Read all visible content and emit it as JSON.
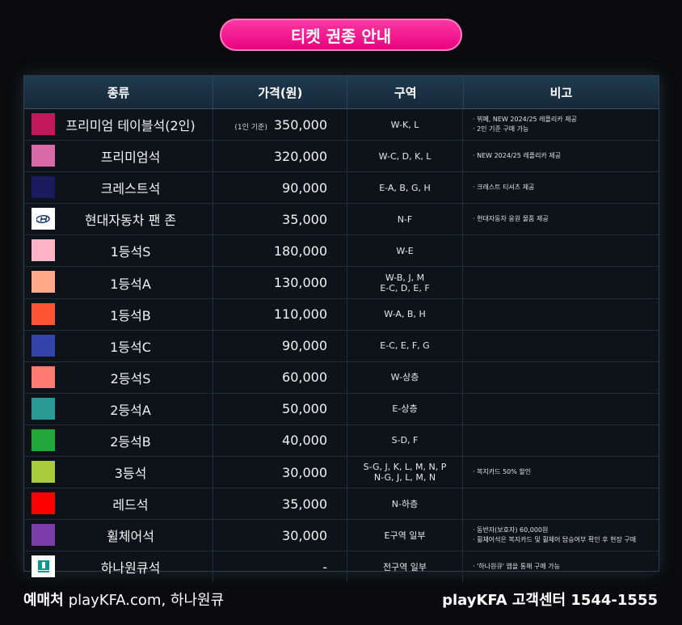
{
  "title": "티켓 권종 안내",
  "table": {
    "headers": [
      "종류",
      "가격(원)",
      "구역",
      "비고"
    ],
    "rows": [
      {
        "color": "#c2185b",
        "icon": "",
        "type": "프리미엄 테이블석(2인)",
        "price_note": "(1인 기준)",
        "price": "350,000",
        "zone": [
          "W-K, L"
        ],
        "notes": [
          "· 뷔페, NEW 2024/25 레플리카 제공",
          "· 2인 기준 구매 가능"
        ]
      },
      {
        "color": "#d96aa8",
        "icon": "",
        "type": "프리미엄석",
        "price_note": "",
        "price": "320,000",
        "zone": [
          "W-C, D, K, L"
        ],
        "notes": [
          "· NEW 2024/25 레플리카 제공"
        ]
      },
      {
        "color": "#1a1a5e",
        "icon": "",
        "type": "크레스트석",
        "price_note": "",
        "price": "90,000",
        "zone": [
          "E-A, B, G, H"
        ],
        "notes": [
          "· 크레스트 티셔츠 제공"
        ]
      },
      {
        "color": "#ffffff",
        "icon": "hyundai-logo-icon",
        "type": "현대자동차 팬 존",
        "price_note": "",
        "price": "35,000",
        "zone": [
          "N-F"
        ],
        "notes": [
          "· 현대자동차 응원 물품 제공"
        ]
      },
      {
        "color": "#ffb3c6",
        "icon": "",
        "type": "1등석S",
        "price_note": "",
        "price": "180,000",
        "zone": [
          "W-E"
        ],
        "notes": []
      },
      {
        "color": "#ffaa88",
        "icon": "",
        "type": "1등석A",
        "price_note": "",
        "price": "130,000",
        "zone": [
          "W-B, J, M",
          "E-C, D, E, F"
        ],
        "notes": []
      },
      {
        "color": "#ff5533",
        "icon": "",
        "type": "1등석B",
        "price_note": "",
        "price": "110,000",
        "zone": [
          "W-A, B, H"
        ],
        "notes": []
      },
      {
        "color": "#3344aa",
        "icon": "",
        "type": "1등석C",
        "price_note": "",
        "price": "90,000",
        "zone": [
          "E-C, E, F, G"
        ],
        "notes": []
      },
      {
        "color": "#ff7a70",
        "icon": "",
        "type": "2등석S",
        "price_note": "",
        "price": "60,000",
        "zone": [
          "W-상층"
        ],
        "notes": []
      },
      {
        "color": "#2a9a95",
        "icon": "",
        "type": "2등석A",
        "price_note": "",
        "price": "50,000",
        "zone": [
          "E-상층"
        ],
        "notes": []
      },
      {
        "color": "#22a83a",
        "icon": "",
        "type": "2등석B",
        "price_note": "",
        "price": "40,000",
        "zone": [
          "S-D, F"
        ],
        "notes": []
      },
      {
        "color": "#a8cc3a",
        "icon": "",
        "type": "3등석",
        "price_note": "",
        "price": "30,000",
        "zone": [
          "S-G, J, K, L, M, N, P",
          "N-G, J, L, M, N"
        ],
        "notes": [
          "· 복지카드 50% 할인"
        ]
      },
      {
        "color": "#ff0000",
        "icon": "",
        "type": "레드석",
        "price_note": "",
        "price": "35,000",
        "zone": [
          "N-하층"
        ],
        "notes": []
      },
      {
        "color": "#7d3da8",
        "icon": "",
        "type": "휠체어석",
        "price_note": "",
        "price": "30,000",
        "zone": [
          "E구역 일부"
        ],
        "notes": [
          "· 동반자(보호자) 60,000원",
          "· 휠체어석은 복지카드 및 휠체어 탑승여부 확인 후 현장 구매"
        ]
      },
      {
        "color": "#ffffff",
        "icon": "hana-one-q-logo-icon",
        "type": "하나원큐석",
        "price_note": "",
        "price": "-",
        "zone": [
          "전구역 일부"
        ],
        "notes": [
          "· '하나원큐' 앱을 통해 구매 가능"
        ]
      }
    ]
  },
  "footer": {
    "left_label": "예매처",
    "left_text": "playKFA.com, 하나원큐",
    "right_text": "playKFA 고객센터 1544-1555"
  }
}
